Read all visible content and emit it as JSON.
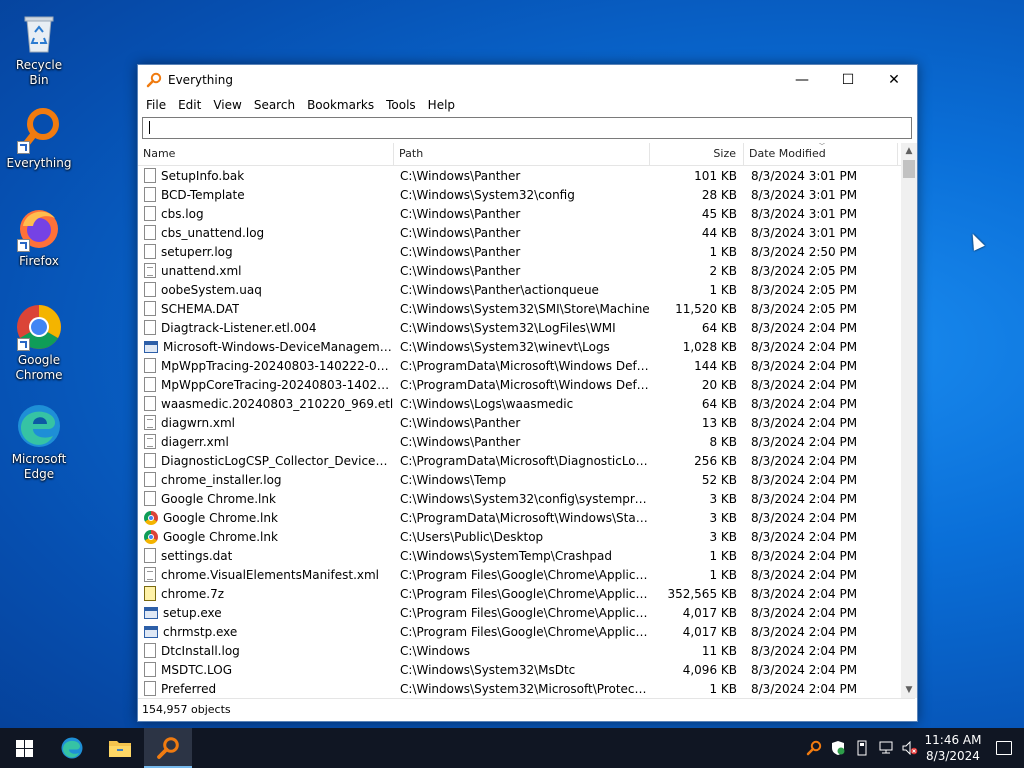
{
  "desktop": {
    "icons": [
      {
        "label": "Recycle Bin",
        "icon": "recycle-bin-icon"
      },
      {
        "label": "Everything",
        "icon": "everything-icon"
      },
      {
        "label": "Firefox",
        "icon": "firefox-icon"
      },
      {
        "label": "Google Chrome",
        "icon": "chrome-icon"
      },
      {
        "label": "Microsoft Edge",
        "icon": "edge-icon"
      }
    ]
  },
  "window": {
    "title": "Everything",
    "controls": {
      "minimize": "—",
      "maximize": "☐",
      "close": "✕"
    },
    "menu": [
      "File",
      "Edit",
      "View",
      "Search",
      "Bookmarks",
      "Tools",
      "Help"
    ],
    "search": {
      "value": "",
      "placeholder": ""
    },
    "columns": {
      "name": "Name",
      "path": "Path",
      "size": "Size",
      "date": "Date Modified"
    },
    "rows": [
      {
        "name": "SetupInfo.bak",
        "path": "C:\\Windows\\Panther",
        "size": "101 KB",
        "date": "8/3/2024 3:01 PM",
        "icon": "file"
      },
      {
        "name": "BCD-Template",
        "path": "C:\\Windows\\System32\\config",
        "size": "28 KB",
        "date": "8/3/2024 3:01 PM",
        "icon": "file"
      },
      {
        "name": "cbs.log",
        "path": "C:\\Windows\\Panther",
        "size": "45 KB",
        "date": "8/3/2024 3:01 PM",
        "icon": "file"
      },
      {
        "name": "cbs_unattend.log",
        "path": "C:\\Windows\\Panther",
        "size": "44 KB",
        "date": "8/3/2024 3:01 PM",
        "icon": "file"
      },
      {
        "name": "setuperr.log",
        "path": "C:\\Windows\\Panther",
        "size": "1 KB",
        "date": "8/3/2024 2:50 PM",
        "icon": "file"
      },
      {
        "name": "unattend.xml",
        "path": "C:\\Windows\\Panther",
        "size": "2 KB",
        "date": "8/3/2024 2:05 PM",
        "icon": "xml"
      },
      {
        "name": "oobeSystem.uaq",
        "path": "C:\\Windows\\Panther\\actionqueue",
        "size": "1 KB",
        "date": "8/3/2024 2:05 PM",
        "icon": "file"
      },
      {
        "name": "SCHEMA.DAT",
        "path": "C:\\Windows\\System32\\SMI\\Store\\Machine",
        "size": "11,520 KB",
        "date": "8/3/2024 2:05 PM",
        "icon": "file"
      },
      {
        "name": "Diagtrack-Listener.etl.004",
        "path": "C:\\Windows\\System32\\LogFiles\\WMI",
        "size": "64 KB",
        "date": "8/3/2024 2:04 PM",
        "icon": "file"
      },
      {
        "name": "Microsoft-Windows-DeviceManagement-...",
        "path": "C:\\Windows\\System32\\winevt\\Logs",
        "size": "1,028 KB",
        "date": "8/3/2024 2:04 PM",
        "icon": "exe"
      },
      {
        "name": "MpWppTracing-20240803-140222-0000000...",
        "path": "C:\\ProgramData\\Microsoft\\Windows Defend...",
        "size": "144 KB",
        "date": "8/3/2024 2:04 PM",
        "icon": "file"
      },
      {
        "name": "MpWppCoreTracing-20240803-140222-000...",
        "path": "C:\\ProgramData\\Microsoft\\Windows Defend...",
        "size": "20 KB",
        "date": "8/3/2024 2:04 PM",
        "icon": "file"
      },
      {
        "name": "waasmedic.20240803_210220_969.etl",
        "path": "C:\\Windows\\Logs\\waasmedic",
        "size": "64 KB",
        "date": "8/3/2024 2:04 PM",
        "icon": "file"
      },
      {
        "name": "diagwrn.xml",
        "path": "C:\\Windows\\Panther",
        "size": "13 KB",
        "date": "8/3/2024 2:04 PM",
        "icon": "xml"
      },
      {
        "name": "diagerr.xml",
        "path": "C:\\Windows\\Panther",
        "size": "8 KB",
        "date": "8/3/2024 2:04 PM",
        "icon": "xml"
      },
      {
        "name": "DiagnosticLogCSP_Collector_DeviceProvis...",
        "path": "C:\\ProgramData\\Microsoft\\DiagnosticLogCS...",
        "size": "256 KB",
        "date": "8/3/2024 2:04 PM",
        "icon": "file"
      },
      {
        "name": "chrome_installer.log",
        "path": "C:\\Windows\\Temp",
        "size": "52 KB",
        "date": "8/3/2024 2:04 PM",
        "icon": "file"
      },
      {
        "name": "Google Chrome.lnk",
        "path": "C:\\Windows\\System32\\config\\systemprofile...",
        "size": "3 KB",
        "date": "8/3/2024 2:04 PM",
        "icon": "file"
      },
      {
        "name": "Google Chrome.lnk",
        "path": "C:\\ProgramData\\Microsoft\\Windows\\Start M...",
        "size": "3 KB",
        "date": "8/3/2024 2:04 PM",
        "icon": "chrome"
      },
      {
        "name": "Google Chrome.lnk",
        "path": "C:\\Users\\Public\\Desktop",
        "size": "3 KB",
        "date": "8/3/2024 2:04 PM",
        "icon": "chrome"
      },
      {
        "name": "settings.dat",
        "path": "C:\\Windows\\SystemTemp\\Crashpad",
        "size": "1 KB",
        "date": "8/3/2024 2:04 PM",
        "icon": "file"
      },
      {
        "name": "chrome.VisualElementsManifest.xml",
        "path": "C:\\Program Files\\Google\\Chrome\\Application",
        "size": "1 KB",
        "date": "8/3/2024 2:04 PM",
        "icon": "xml"
      },
      {
        "name": "chrome.7z",
        "path": "C:\\Program Files\\Google\\Chrome\\Applicatio...",
        "size": "352,565 KB",
        "date": "8/3/2024 2:04 PM",
        "icon": "zip"
      },
      {
        "name": "setup.exe",
        "path": "C:\\Program Files\\Google\\Chrome\\Applicatio...",
        "size": "4,017 KB",
        "date": "8/3/2024 2:04 PM",
        "icon": "exe"
      },
      {
        "name": "chrmstp.exe",
        "path": "C:\\Program Files\\Google\\Chrome\\Applicatio...",
        "size": "4,017 KB",
        "date": "8/3/2024 2:04 PM",
        "icon": "exe"
      },
      {
        "name": "DtcInstall.log",
        "path": "C:\\Windows",
        "size": "11 KB",
        "date": "8/3/2024 2:04 PM",
        "icon": "file"
      },
      {
        "name": "MSDTC.LOG",
        "path": "C:\\Windows\\System32\\MsDtc",
        "size": "4,096 KB",
        "date": "8/3/2024 2:04 PM",
        "icon": "file"
      },
      {
        "name": "Preferred",
        "path": "C:\\Windows\\System32\\Microsoft\\Protect\\S-...",
        "size": "1 KB",
        "date": "8/3/2024 2:04 PM",
        "icon": "file"
      }
    ],
    "status": "154,957 objects"
  },
  "taskbar": {
    "apps": [
      "start-icon",
      "edge-icon",
      "file-explorer-icon",
      "everything-icon"
    ],
    "clock": {
      "time": "11:46 AM",
      "date": "8/3/2024"
    }
  }
}
